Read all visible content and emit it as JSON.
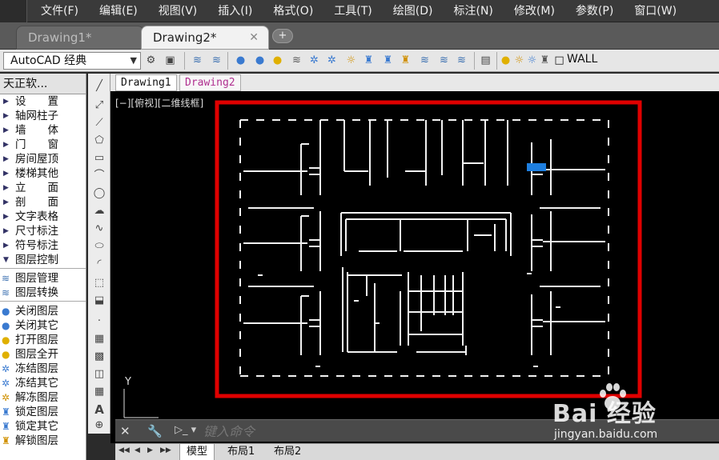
{
  "menubar": {
    "items": [
      "文件(F)",
      "编辑(E)",
      "视图(V)",
      "插入(I)",
      "格式(O)",
      "工具(T)",
      "绘图(D)",
      "标注(N)",
      "修改(M)",
      "参数(P)",
      "窗口(W)"
    ]
  },
  "doc_tabs": {
    "tab1": "Drawing1*",
    "tab2": "Drawing2*",
    "close_glyph": "✕",
    "new_tab_glyph": "+"
  },
  "toolbar": {
    "workspace": "AutoCAD 经典",
    "current_layer": "WALL"
  },
  "tool_palette": {
    "title": "天正软...",
    "groups": [
      "设　　置",
      "轴网柱子",
      "墙　　体",
      "门　　窗",
      "房间屋顶",
      "楼梯其他",
      "立　　面",
      "剖　　面",
      "文字表格",
      "尺寸标注",
      "符号标注",
      "图层控制"
    ],
    "layer_tools": [
      "图层管理",
      "图层转换"
    ],
    "layer_ops": [
      "关闭图层",
      "关闭其它",
      "打开图层",
      "图层全开",
      "冻结图层",
      "冻结其它",
      "解冻图层",
      "锁定图层",
      "锁定其它",
      "解锁图层"
    ]
  },
  "drawing_tabs": [
    "Drawing1",
    "Drawing2"
  ],
  "viewport": {
    "label": "[−][俯视][二维线框]",
    "ucs_y": "Y",
    "highlight_color": "#e00000",
    "selection_color": "#1e7fe0"
  },
  "command": {
    "placeholder": "键入命令",
    "prompt_glyph": "▷_ ▾"
  },
  "layout_tabs": [
    "模型",
    "布局1",
    "布局2"
  ],
  "watermark": {
    "brand": "Bai   经验",
    "url": "jingyan.baidu.com"
  },
  "icons": {
    "toolbar": [
      "gear-icon",
      "layer-icon",
      "bulb-icon",
      "sun-icon",
      "lock-icon"
    ],
    "draw": [
      "line-icon",
      "construction-line-icon",
      "polyline-icon",
      "polygon-icon",
      "rectangle-icon",
      "arc-icon",
      "circle-icon",
      "cloud-icon",
      "spline-icon",
      "ellipse-icon",
      "ellipse-arc-icon",
      "insert-block-icon",
      "make-block-icon",
      "point-icon",
      "hatch-icon",
      "gradient-icon",
      "region-icon",
      "table-icon",
      "text-icon",
      "add-selected-icon"
    ]
  }
}
